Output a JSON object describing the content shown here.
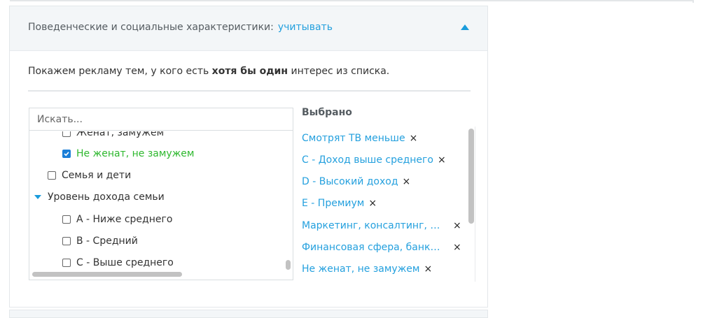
{
  "section": {
    "title": "Поведенческие и социальные характеристики:",
    "status": "учитывать",
    "toggle_icon": "triangle-up-icon",
    "accent_color": "#24a0de"
  },
  "description": {
    "before": "Покажем рекламу тем, у кого есть ",
    "bold": "хотя бы один",
    "after": " интерес из списка."
  },
  "search": {
    "placeholder": "Искать...",
    "value": ""
  },
  "tree": {
    "items": [
      {
        "label": "Женат, замужем",
        "checked": false
      },
      {
        "label": "Не женат, не замужем",
        "checked": true
      },
      {
        "label": "Семья и дети",
        "checked": false
      },
      {
        "label": "Уровень дохода семьи",
        "expanded": true
      },
      {
        "label": "A - Ниже среднего",
        "checked": false
      },
      {
        "label": "B - Средний",
        "checked": false
      },
      {
        "label": "C - Выше среднего",
        "checked": false
      }
    ],
    "checked_color": "#2eb82e"
  },
  "selected": {
    "title": "Выбрано",
    "remove_symbol": "×",
    "items": [
      {
        "label": "Смотрят ТВ меньше"
      },
      {
        "label": "C - Доход выше среднего"
      },
      {
        "label": "D - Высокий доход"
      },
      {
        "label": "E - Премиум"
      },
      {
        "label": "Маркетинг, консалтинг, р..."
      },
      {
        "label": "Финансовая сфера, банко..."
      },
      {
        "label": "Не женат, не замужем"
      }
    ]
  }
}
